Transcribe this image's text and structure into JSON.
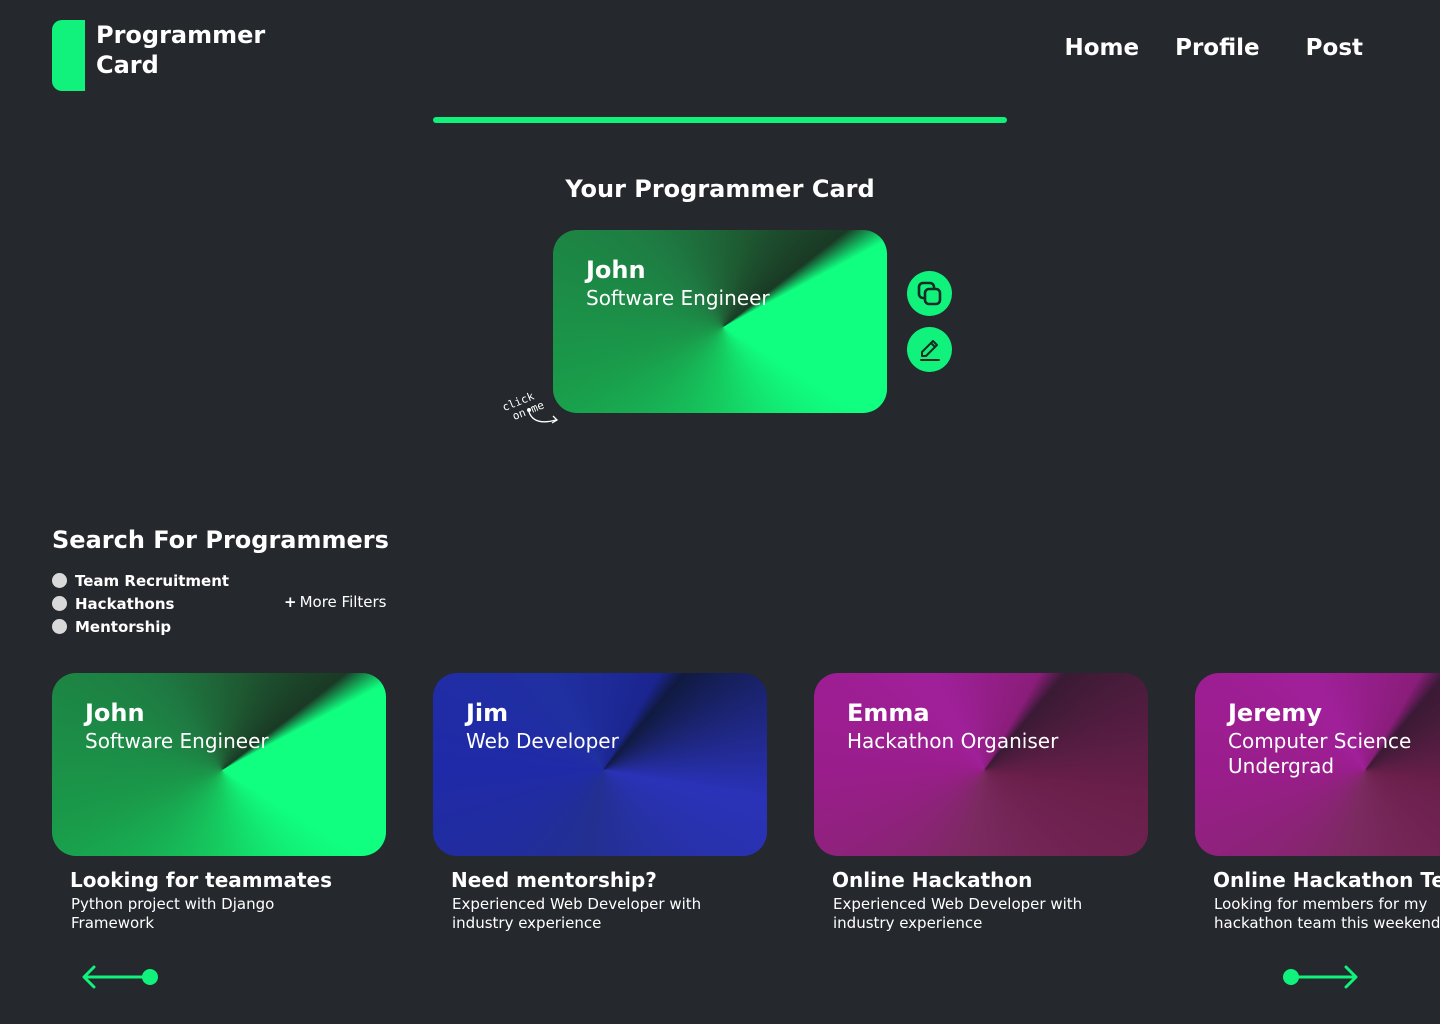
{
  "brand": {
    "title": "Programmer Card",
    "accent_color": "#10f27c",
    "background_color": "#25282c"
  },
  "nav": {
    "items": [
      "Home",
      "Profile",
      "Post"
    ]
  },
  "your_card": {
    "section_title": "Your Programmer Card",
    "name": "John",
    "role": "Software Engineer",
    "hint": "click on me",
    "actions": [
      {
        "name": "copy",
        "icon": "copy-icon"
      },
      {
        "name": "edit",
        "icon": "pencil-icon"
      }
    ]
  },
  "search": {
    "title": "Search For Programmers",
    "filters": [
      "Team Recruitment",
      "Hackathons",
      "Mentorship"
    ],
    "more_filters": "More Filters",
    "more_filters_icon": "+"
  },
  "listings": [
    {
      "name": "John",
      "role": "Software Engineer",
      "theme": "green",
      "title": "Looking for teammates",
      "description": "Python project with Django Framework"
    },
    {
      "name": "Jim",
      "role": "Web Developer",
      "theme": "blue",
      "title": "Need mentorship?",
      "description": "Experienced Web Developer with industry experience"
    },
    {
      "name": "Emma",
      "role": "Hackathon Organiser",
      "theme": "pink",
      "title": "Online Hackathon",
      "description": "Experienced Web Developer with industry experience"
    },
    {
      "name": "Jeremy",
      "role": "Computer Science Undergrad",
      "theme": "pink",
      "title": "Online Hackathon Team",
      "description": "Looking for members for my hackathon team this weekend"
    }
  ],
  "carousel": {
    "prev_icon": "arrow-left-icon",
    "next_icon": "arrow-right-icon"
  }
}
